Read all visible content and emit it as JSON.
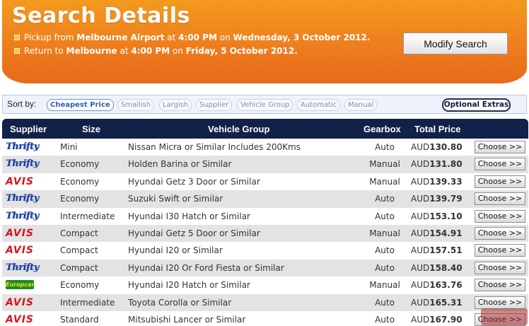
{
  "header": {
    "title": "Search Details",
    "pickup": {
      "prefix": "Pickup from",
      "location": "Melbourne Airport",
      "at": "at",
      "time": "4:00 PM",
      "on": "on",
      "date": "Wednesday, 3 October 2012."
    },
    "return": {
      "prefix": "Return to",
      "location": "Melbourne",
      "at": "at",
      "time": "4:00 PM",
      "on": "on",
      "date": "Friday, 5 October 2012."
    },
    "modify_label": "Modify Search",
    "colors": {
      "orange": "#ee7e1d",
      "text": "#ffffff"
    }
  },
  "sortbar": {
    "label": "Sort by:",
    "options": [
      "Cheapest Price",
      "Smallish",
      "Largish",
      "Supplier",
      "Vehicle Group",
      "Automatic",
      "Manual"
    ],
    "active": "Cheapest Price",
    "extras_label": "Optional Extras"
  },
  "table": {
    "headers": [
      "Supplier",
      "Size",
      "Vehicle Group",
      "Gearbox",
      "Total Price"
    ],
    "choose_label": "Choose >>",
    "currency": "AUD",
    "rows": [
      {
        "supplier": "Thrifty",
        "size": "Mini",
        "vehicle": "Nissan Micra or Similar Includes 200Kms",
        "gearbox": "Auto",
        "price": "130.80"
      },
      {
        "supplier": "Thrifty",
        "size": "Economy",
        "vehicle": "Holden Barina or Similar",
        "gearbox": "Manual",
        "price": "131.80"
      },
      {
        "supplier": "AVIS",
        "size": "Economy",
        "vehicle": "Hyundai Getz 3 Door or Similar",
        "gearbox": "Manual",
        "price": "139.33"
      },
      {
        "supplier": "Thrifty",
        "size": "Economy",
        "vehicle": "Suzuki Swift or Similar",
        "gearbox": "Auto",
        "price": "139.79"
      },
      {
        "supplier": "Thrifty",
        "size": "Intermediate",
        "vehicle": "Hyundai I30 Hatch or Similar",
        "gearbox": "Auto",
        "price": "153.10"
      },
      {
        "supplier": "AVIS",
        "size": "Compact",
        "vehicle": "Hyundai Getz 5 Door or Similar",
        "gearbox": "Manual",
        "price": "154.91"
      },
      {
        "supplier": "AVIS",
        "size": "Compact",
        "vehicle": "Hyundai I20 or Similar",
        "gearbox": "Auto",
        "price": "157.51"
      },
      {
        "supplier": "Thrifty",
        "size": "Compact",
        "vehicle": "Hyundai I20 Or Ford Fiesta or Similar",
        "gearbox": "Auto",
        "price": "158.40"
      },
      {
        "supplier": "Europcar",
        "size": "Economy",
        "vehicle": "Hyundai I20 Hatch or Similar",
        "gearbox": "Manual",
        "price": "163.76"
      },
      {
        "supplier": "AVIS",
        "size": "Intermediate",
        "vehicle": "Toyota Corolla or Similar",
        "gearbox": "Auto",
        "price": "165.31"
      },
      {
        "supplier": "AVIS",
        "size": "Standard",
        "vehicle": "Mitsubishi Lancer or Similar",
        "gearbox": "Auto",
        "price": "167.90"
      }
    ]
  }
}
